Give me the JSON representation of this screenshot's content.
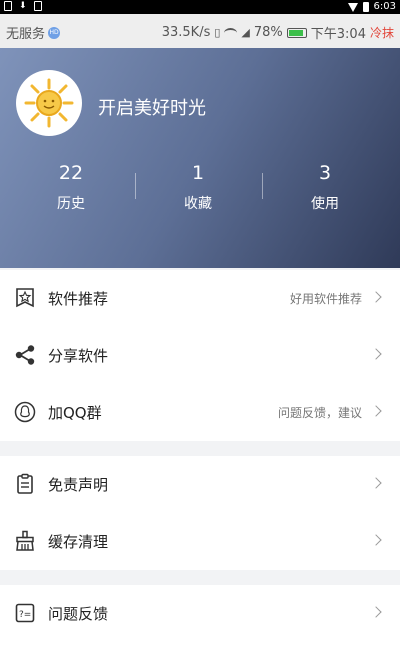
{
  "statusbar": {
    "time": "6:03",
    "operator": "无服务",
    "hd_label": "HD",
    "speed": "33.5K/s",
    "battery": "78%",
    "clock": "下午3:04",
    "badge": "冷抹"
  },
  "profile": {
    "name": "开启美好时光",
    "stats": [
      {
        "value": "22",
        "label": "历史"
      },
      {
        "value": "1",
        "label": "收藏"
      },
      {
        "value": "3",
        "label": "使用"
      }
    ]
  },
  "menu": {
    "group1": [
      {
        "label": "软件推荐",
        "hint": "好用软件推荐",
        "icon": "star-badge-icon"
      },
      {
        "label": "分享软件",
        "hint": "",
        "icon": "share-icon"
      },
      {
        "label": "加QQ群",
        "hint": "问题反馈，建议",
        "icon": "qq-icon"
      }
    ],
    "group2": [
      {
        "label": "免责声明",
        "hint": "",
        "icon": "clipboard-icon"
      },
      {
        "label": "缓存清理",
        "hint": "",
        "icon": "broom-icon"
      }
    ],
    "group3": [
      {
        "label": "问题反馈",
        "hint": "",
        "icon": "feedback-icon"
      }
    ]
  }
}
